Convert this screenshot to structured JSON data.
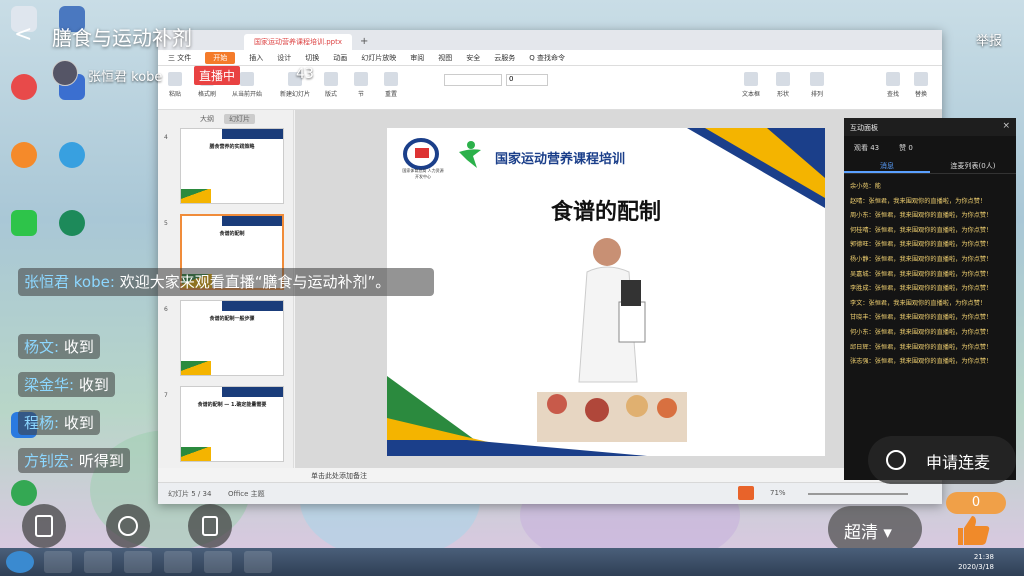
{
  "live": {
    "back_glyph": "<",
    "title": "膳食与运动补剂",
    "host_name": "张恒君 kobe",
    "badge": "直播中",
    "viewers": "43",
    "report": "举报"
  },
  "chat": [
    {
      "user": "张恒君 kobe:",
      "text": "欢迎大家来观看直播“膳食与运动补剂”。"
    },
    {
      "user": "杨文:",
      "text": "收到"
    },
    {
      "user": "梁金华:",
      "text": "收到"
    },
    {
      "user": "程杨:",
      "text": "收到"
    },
    {
      "user": "方钊宏:",
      "text": "听得到"
    }
  ],
  "buttons": {
    "apply_mic": "申请连麦",
    "quality": "超清",
    "like_count": "0"
  },
  "wps": {
    "file_tab": "国家运动营养课程培训.pptx",
    "menu": [
      "三 文件",
      "开始",
      "插入",
      "设计",
      "切换",
      "动画",
      "幻灯片放映",
      "审阅",
      "视图",
      "安全",
      "云服务",
      "Q 查找命令"
    ],
    "active_menu": "开始",
    "ribbon": [
      {
        "label": "粘贴"
      },
      {
        "label": "格式刷"
      },
      {
        "label": "从当前开始"
      },
      {
        "label": "新建幻灯片"
      },
      {
        "label": "版式"
      },
      {
        "label": "节"
      },
      {
        "label": "重置"
      },
      {
        "label": "文本框"
      },
      {
        "label": "形状"
      },
      {
        "label": "排列"
      },
      {
        "label": "查找"
      },
      {
        "label": "替换"
      }
    ],
    "font_size": "0",
    "panel_tabs": [
      "大纲",
      "幻灯片"
    ],
    "thumbnails": [
      {
        "num": "4",
        "title": "膳食营养的实践策略"
      },
      {
        "num": "5",
        "title": "食谱的配制"
      },
      {
        "num": "6",
        "title": "食谱的配制一般步骤"
      },
      {
        "num": "7",
        "title": "食谱的配制 — 1.确定能量需要"
      }
    ],
    "notes": "单击此处添加备注",
    "status_slide": "幻灯片 5 / 34",
    "status_theme": "Office 主题",
    "zoom": "71%"
  },
  "slide": {
    "program": "国家运动营养课程培训",
    "heading": "食谱的配制",
    "logo_text": "国家体育总局 人力资源开发中心"
  },
  "panel": {
    "title": "互动面板",
    "viewers": "观看 43",
    "likes": "赞 0",
    "tab_messages": "消息",
    "tab_mic": "连麦列表(0人)",
    "messages": [
      "余小苑：能",
      "赵晴：张恒君，我来围观你的直播啦，为你点赞！",
      "周小东：张恒君，我来围观你的直播啦，为你点赞！",
      "何桂晴：张恒君，我来围观你的直播啦，为你点赞！",
      "郭德旺：张恒君，我来围观你的直播啦，为你点赞！",
      "杨小静：张恒君，我来围观你的直播啦，为你点赞！",
      "吴嘉城：张恒君，我来围观你的直播啦，为你点赞！",
      "李胜成：张恒君，我来围观你的直播啦，为你点赞！",
      "李文：张恒君，我来围观你的直播啦，为你点赞！",
      "甘晓丰：张恒君，我来围观你的直播啦，为你点赞！",
      "何小东：张恒君，我来围观你的直播啦，为你点赞！",
      "邱日辉：张恒君，我来围观你的直播啦，为你点赞！",
      "张志强：张恒君，我来围观你的直播啦，为你点赞！"
    ]
  },
  "taskbar": {
    "time": "21:38",
    "date": "2020/3/18"
  },
  "colors": {
    "accent_orange": "#f47b2a",
    "live_red": "#e94242",
    "slide_blue": "#1b3f8a",
    "slide_green": "#2b8a3e",
    "slide_yellow": "#f4b400"
  }
}
